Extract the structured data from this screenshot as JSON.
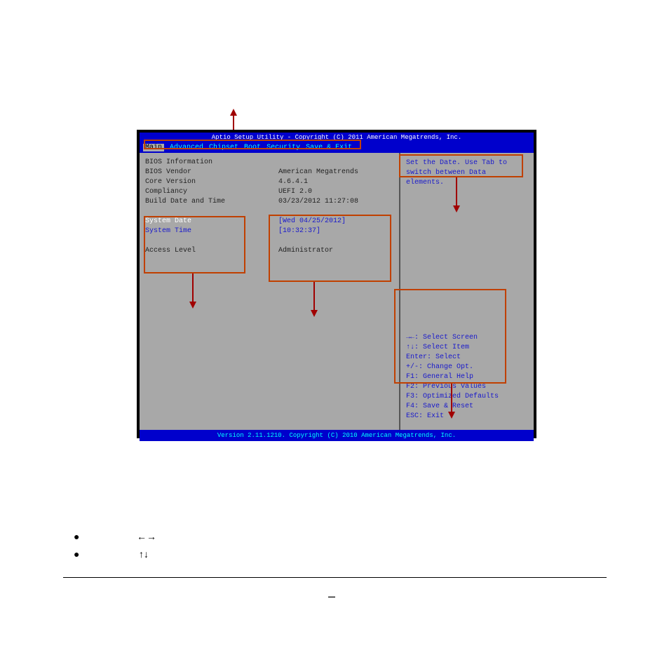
{
  "bios": {
    "header_title": "Aptio Setup Utility - Copyright (C) 2011 American Megatrends, Inc.",
    "tabs": [
      "Main",
      "Advanced",
      "Chipset",
      "Boot",
      "Security",
      "Save & Exit"
    ],
    "active_tab": 0,
    "section_title": "BIOS Information",
    "info": {
      "vendor_label": "BIOS Vendor",
      "vendor_value": "American Megatrends",
      "core_label": "Core Version",
      "core_value": "4.6.4.1",
      "compliancy_label": "Compliancy",
      "compliancy_value": "UEFI 2.0",
      "build_label": "Build Date and Time",
      "build_value": "03/23/2012 11:27:08",
      "date_label": "System Date",
      "date_value": "[Wed 04/25/2012]",
      "time_label": "System Time",
      "time_value": "[10:32:37]",
      "access_label": "Access Level",
      "access_value": "Administrator"
    },
    "help_text_1": "Set the Date. Use Tab to",
    "help_text_2": "switch between Data elements.",
    "keys": {
      "k1": "→←: Select Screen",
      "k2": "↑↓: Select Item",
      "k3": "Enter: Select",
      "k4": "+/-: Change Opt.",
      "k5": "F1: General Help",
      "k6": "F2: Previous Values",
      "k7": "F3: Optimized Defaults",
      "k8": "F4: Save & Reset",
      "k9": "ESC: Exit"
    },
    "footer": "Version 2.11.1210. Copyright (C) 2010 American Megatrends, Inc."
  },
  "doc": {
    "arrows": "←→",
    "updown": "↑↓"
  }
}
